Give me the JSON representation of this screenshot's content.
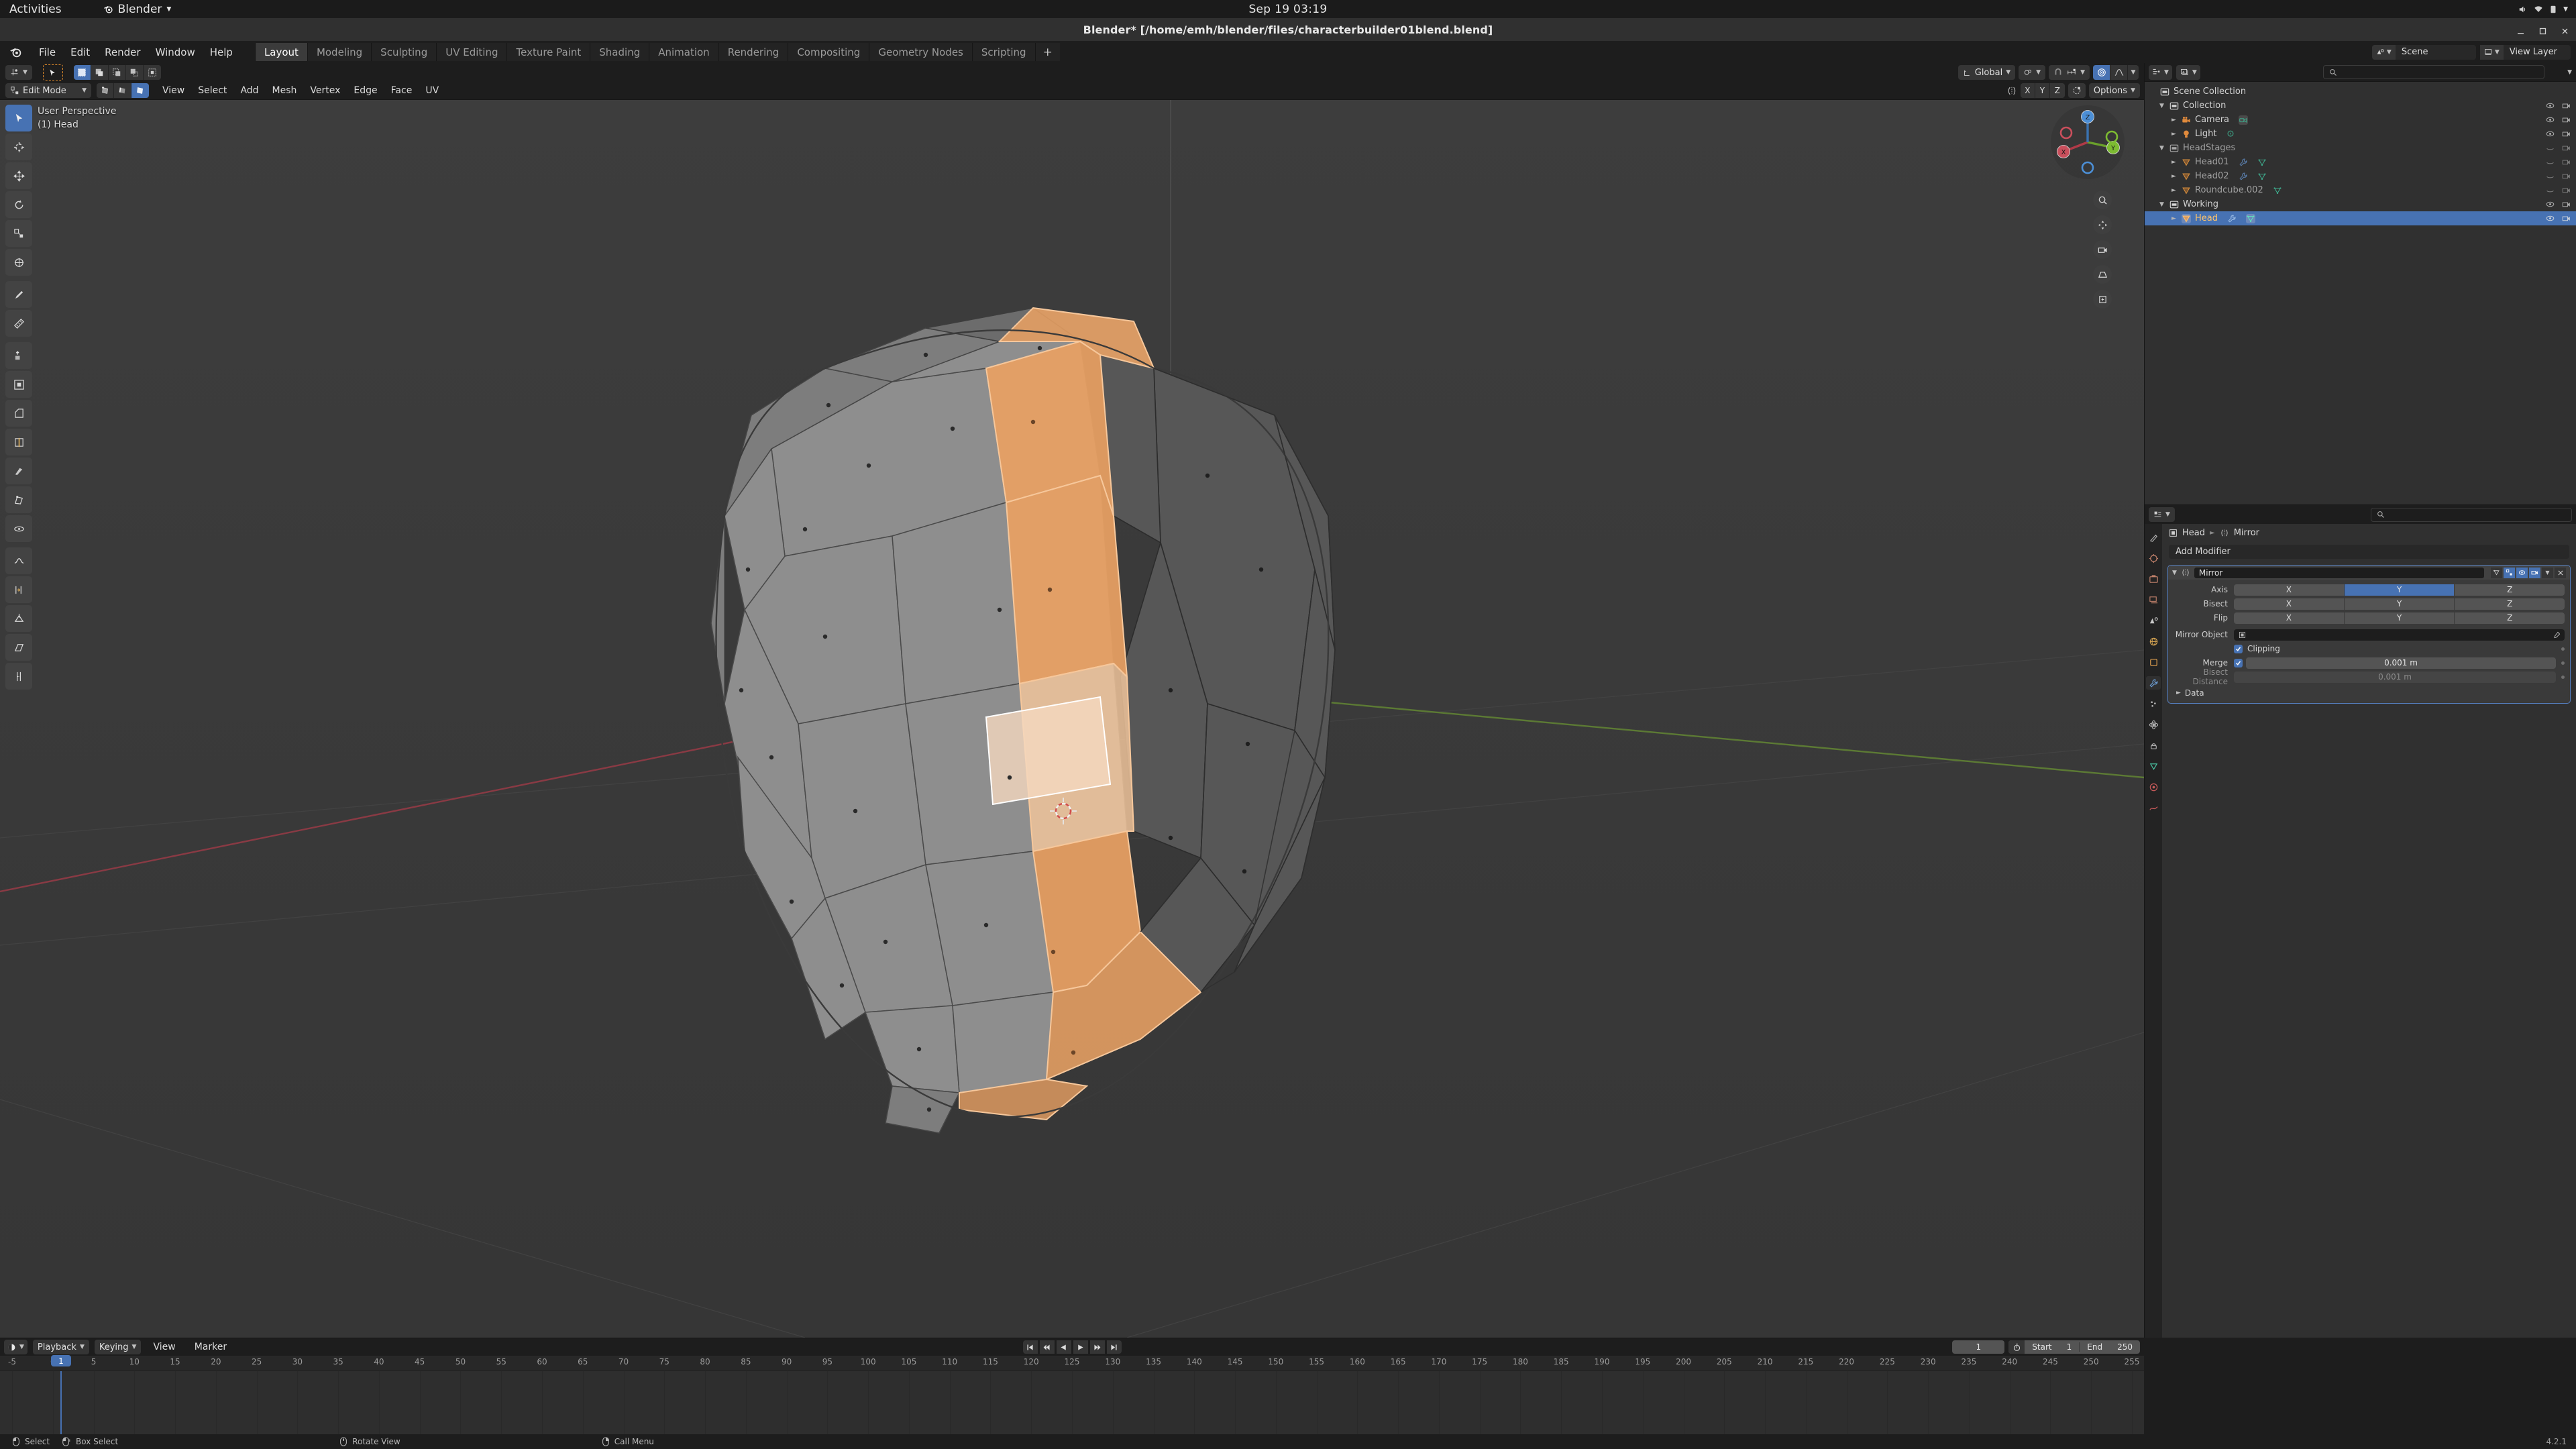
{
  "gnome": {
    "activities": "Activities",
    "app_name": "Blender",
    "clock": "Sep 19  03:19"
  },
  "window": {
    "title": "Blender* [/home/emh/blender/files/characterbuilder01blend.blend]"
  },
  "topbar": {
    "menus": [
      "File",
      "Edit",
      "Render",
      "Window",
      "Help"
    ],
    "workspaces": [
      {
        "label": "Layout",
        "active": true
      },
      {
        "label": "Modeling",
        "active": false
      },
      {
        "label": "Sculpting",
        "active": false
      },
      {
        "label": "UV Editing",
        "active": false
      },
      {
        "label": "Texture Paint",
        "active": false
      },
      {
        "label": "Shading",
        "active": false
      },
      {
        "label": "Animation",
        "active": false
      },
      {
        "label": "Rendering",
        "active": false
      },
      {
        "label": "Compositing",
        "active": false
      },
      {
        "label": "Geometry Nodes",
        "active": false
      },
      {
        "label": "Scripting",
        "active": false
      }
    ],
    "add_workspace": "+",
    "scene_name": "Scene",
    "view_layer_name": "View Layer"
  },
  "viewport": {
    "mode": "Edit Mode",
    "menus": [
      "View",
      "Select",
      "Add",
      "Mesh",
      "Vertex",
      "Edge",
      "Face",
      "UV"
    ],
    "transform_orientation": "Global",
    "options_label": "Options",
    "proportional_axes": [
      "X",
      "Y",
      "Z"
    ],
    "overlay_line1": "User Perspective",
    "overlay_line2": "(1) Head",
    "select_modes": [
      "vertex-select",
      "edge-select",
      "face-select"
    ],
    "active_select_mode": "face-select"
  },
  "outliner": {
    "search_placeholder": "",
    "rows": [
      {
        "label": "Scene Collection",
        "depth": 0,
        "icon": "collection-icon",
        "disclosure": "",
        "selected": false,
        "dim": false
      },
      {
        "label": "Collection",
        "depth": 1,
        "icon": "collection-icon",
        "disclosure": "▼",
        "selected": false,
        "dim": false
      },
      {
        "label": "Camera",
        "depth": 2,
        "icon": "camera-icon",
        "disclosure": "►",
        "selected": false,
        "dim": false
      },
      {
        "label": "Light",
        "depth": 2,
        "icon": "light-icon",
        "disclosure": "►",
        "selected": false,
        "dim": false
      },
      {
        "label": "HeadStages",
        "depth": 1,
        "icon": "collection-icon",
        "disclosure": "▼",
        "selected": false,
        "dim": true
      },
      {
        "label": "Head01",
        "depth": 2,
        "icon": "mesh-object-icon",
        "disclosure": "►",
        "selected": false,
        "dim": true
      },
      {
        "label": "Head02",
        "depth": 2,
        "icon": "mesh-object-icon",
        "disclosure": "►",
        "selected": false,
        "dim": true
      },
      {
        "label": "Roundcube.002",
        "depth": 2,
        "icon": "mesh-object-icon",
        "disclosure": "►",
        "selected": false,
        "dim": true
      },
      {
        "label": "Working",
        "depth": 1,
        "icon": "collection-icon",
        "disclosure": "▼",
        "selected": false,
        "dim": false
      },
      {
        "label": "Head",
        "depth": 2,
        "icon": "mesh-object-icon",
        "disclosure": "►",
        "selected": true,
        "dim": false
      }
    ]
  },
  "properties": {
    "breadcrumb_object": "Head",
    "breadcrumb_modifier": "Mirror",
    "add_modifier_label": "Add Modifier",
    "modifier": {
      "name": "Mirror",
      "axis_label": "Axis",
      "axis_options": [
        "X",
        "Y",
        "Z"
      ],
      "axis_active": "Y",
      "bisect_label": "Bisect",
      "bisect_options": [
        "X",
        "Y",
        "Z"
      ],
      "flip_label": "Flip",
      "flip_options": [
        "X",
        "Y",
        "Z"
      ],
      "mirror_object_label": "Mirror Object",
      "mirror_object_value": "",
      "clipping_label": "Clipping",
      "clipping_checked": true,
      "merge_label": "Merge",
      "merge_checked": true,
      "merge_value": "0.001 m",
      "bisect_distance_label": "Bisect Distance",
      "bisect_distance_value": "0.001 m",
      "data_label": "Data"
    }
  },
  "timeline": {
    "editor_menus": [
      "Playback",
      "Keying",
      "View",
      "Marker"
    ],
    "current_frame": "1",
    "start_label": "Start",
    "start_value": "1",
    "end_label": "End",
    "end_value": "250",
    "ticks": [
      "-5",
      "0",
      "5",
      "10",
      "15",
      "20",
      "25",
      "30",
      "35",
      "40",
      "45",
      "50",
      "55",
      "60",
      "65",
      "70",
      "75",
      "80",
      "85",
      "90",
      "95",
      "100",
      "105",
      "110",
      "115",
      "120",
      "125",
      "130",
      "135",
      "140",
      "145",
      "150",
      "155",
      "160",
      "165",
      "170",
      "175",
      "180",
      "185",
      "190",
      "195",
      "200",
      "205",
      "210",
      "215",
      "220",
      "225",
      "230",
      "235",
      "240",
      "245",
      "250",
      "255"
    ],
    "playhead_label": "1"
  },
  "statusbar": {
    "items": [
      {
        "icon": "mouse-left-icon",
        "label": "Select"
      },
      {
        "icon": "mouse-drag-icon",
        "label": "Box Select"
      },
      {
        "icon": "mouse-middle-icon",
        "label": "Rotate View"
      },
      {
        "icon": "mouse-right-icon",
        "label": "Call Menu"
      }
    ],
    "version": "4.2.1"
  },
  "colors": {
    "accent_blue": "#4772b3",
    "selected_orange": "#e8a063",
    "bg_dark": "#1d1d1d",
    "panel": "#303030",
    "viewport_bg": "#393939"
  }
}
